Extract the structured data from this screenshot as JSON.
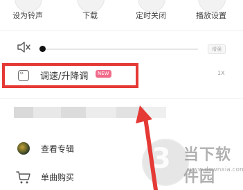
{
  "top_actions": [
    {
      "label": "设为铃声"
    },
    {
      "label": "下载"
    },
    {
      "label": "定时关闭"
    },
    {
      "label": "播放设置"
    }
  ],
  "volume": {
    "level": 0.0,
    "enhance_label": "增强"
  },
  "speed": {
    "label": "调速/升降调",
    "badge": "NEW",
    "value": "1X"
  },
  "menu": {
    "view_album": {
      "label": "查看专辑",
      "icon": "album-cover-icon"
    },
    "buy_single": {
      "label": "单曲购买",
      "icon": "cart-icon"
    }
  },
  "watermark": {
    "glyph": "3",
    "title": "当下软件园",
    "url": "www.downxia.com"
  },
  "colors": {
    "highlight": "#e53935",
    "new_badge": "#f06a8a",
    "arrow": "#e53935"
  }
}
